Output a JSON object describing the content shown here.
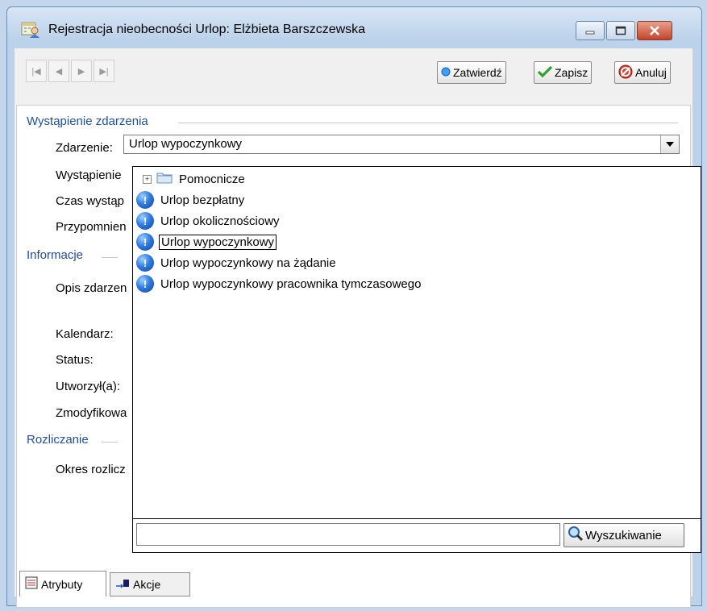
{
  "window": {
    "title": "Rejestracja nieobecności Urlop: Elżbieta Barszczewska"
  },
  "toolbar": {
    "nav": [
      "first-record",
      "previous-record",
      "next-record",
      "last-record"
    ],
    "confirm_label": "Zatwierdź",
    "save_label": "Zapisz",
    "cancel_label": "Anuluj"
  },
  "sections": {
    "occurrence": "Wystąpienie zdarzenia",
    "information": "Informacje",
    "settlement": "Rozliczanie"
  },
  "labels": {
    "event": "Zdarzenie:",
    "occurrence": "Wystąpienie",
    "time": "Czas wystąp",
    "reminder": "Przypomnien",
    "description": "Opis zdarzen",
    "calendar": "Kalendarz:",
    "status": "Status:",
    "created_by": "Utworzył(a):",
    "modified_by": "Zmodyfikowa",
    "settlement_period": "Okres rozlicz"
  },
  "event_combo": {
    "value": "Urlop wypoczynkowy"
  },
  "dropdown": {
    "folder": "Pomocnicze",
    "items": [
      "Urlop bezpłatny",
      "Urlop okolicznościowy",
      "Urlop wypoczynkowy",
      "Urlop wypoczynkowy na żądanie",
      "Urlop wypoczynkowy pracownika tymczasowego"
    ],
    "selected_index": 2,
    "search_placeholder": "",
    "search_button": "Wyszukiwanie"
  },
  "tabs": {
    "attributes": "Atrybuty",
    "actions": "Akcje"
  },
  "colors": {
    "section_header": "#1f4fa0",
    "info_icon": "#2f7ce0"
  }
}
